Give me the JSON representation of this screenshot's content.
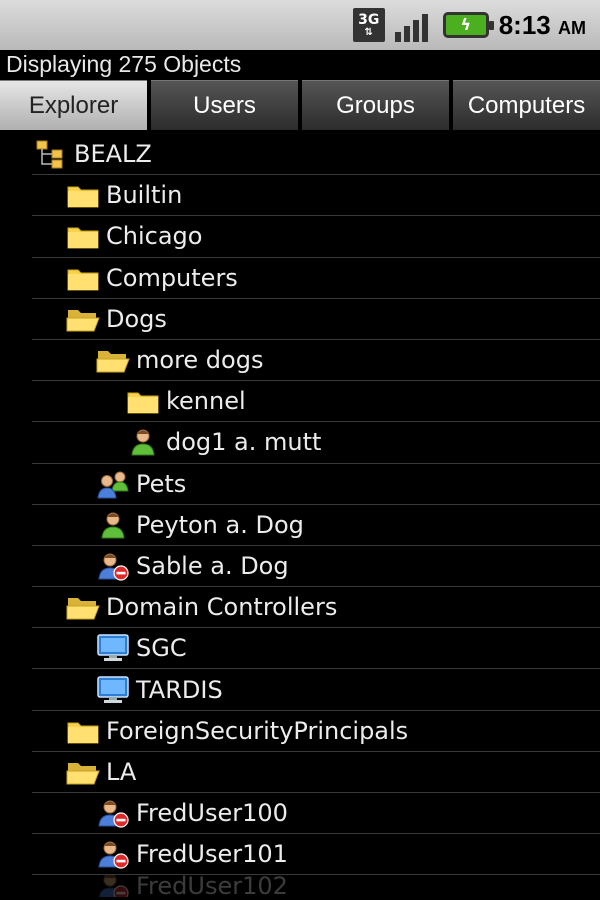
{
  "status_bar": {
    "network": "3G",
    "time": "8:13",
    "ampm": "AM",
    "signal_icon": "signal-bars",
    "battery_icon": "battery-charging"
  },
  "header": {
    "subtitle": "Displaying 275 Objects"
  },
  "tabs": [
    {
      "label": "Explorer",
      "active": true
    },
    {
      "label": "Users",
      "active": false
    },
    {
      "label": "Groups",
      "active": false
    },
    {
      "label": "Computers",
      "active": false
    }
  ],
  "tree": [
    {
      "label": "BEALZ",
      "icon": "domain-tree-icon",
      "level": 0
    },
    {
      "label": "Builtin",
      "icon": "folder-closed-icon",
      "level": 1
    },
    {
      "label": "Chicago",
      "icon": "folder-closed-icon",
      "level": 1
    },
    {
      "label": "Computers",
      "icon": "folder-closed-icon",
      "level": 1
    },
    {
      "label": "Dogs",
      "icon": "folder-open-icon",
      "level": 1
    },
    {
      "label": "more dogs",
      "icon": "folder-open-icon",
      "level": 2
    },
    {
      "label": "kennel",
      "icon": "folder-closed-icon",
      "level": 3
    },
    {
      "label": "dog1 a. mutt",
      "icon": "user-icon",
      "level": 3
    },
    {
      "label": "Pets",
      "icon": "group-icon",
      "level": 2
    },
    {
      "label": "Peyton a. Dog",
      "icon": "user-icon",
      "level": 2
    },
    {
      "label": "Sable a. Dog",
      "icon": "user-disabled-icon",
      "level": 2
    },
    {
      "label": "Domain Controllers",
      "icon": "folder-open-icon",
      "level": 1
    },
    {
      "label": "SGC",
      "icon": "computer-icon",
      "level": 2
    },
    {
      "label": "TARDIS",
      "icon": "computer-icon",
      "level": 2
    },
    {
      "label": "ForeignSecurityPrincipals",
      "icon": "folder-closed-icon",
      "level": 1
    },
    {
      "label": "LA",
      "icon": "folder-open-icon",
      "level": 1
    },
    {
      "label": "FredUser100",
      "icon": "user-disabled-icon",
      "level": 2
    },
    {
      "label": "FredUser101",
      "icon": "user-disabled-icon",
      "level": 2
    },
    {
      "label": "FredUser102",
      "icon": "user-disabled-icon",
      "level": 2
    }
  ]
}
